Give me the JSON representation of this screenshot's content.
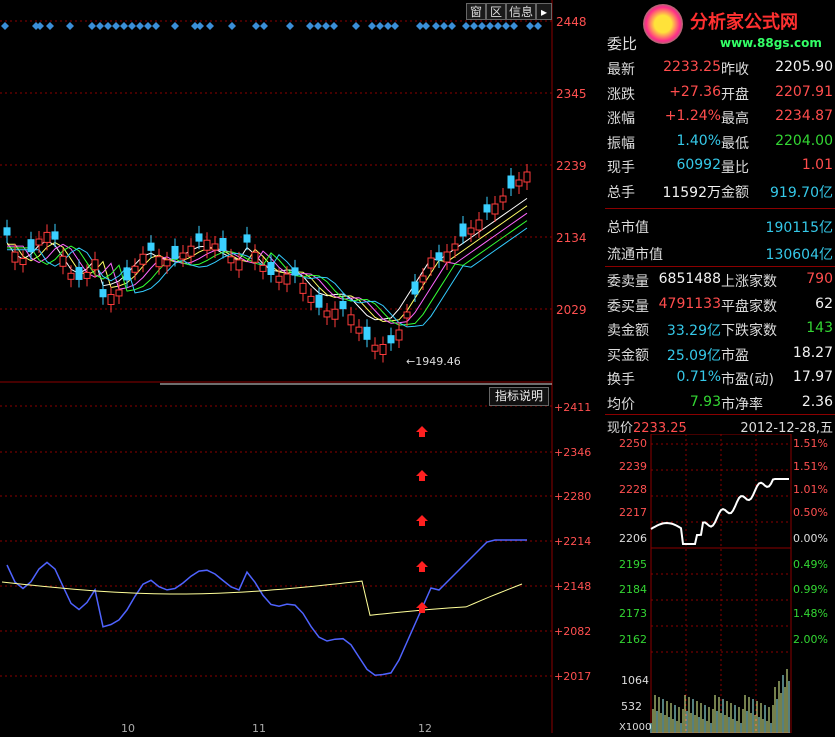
{
  "toolbar": {
    "btn1": "窗",
    "btn2": "区",
    "btn3": "信息",
    "btn4": "▸"
  },
  "kline_axis": [
    "2448",
    "2345",
    "2239",
    "2134",
    "2029"
  ],
  "low_annotation": "1949.46",
  "indicator_button": "指标说明",
  "indicator_axis": [
    "+2411",
    "+2346",
    "+2280",
    "+2214",
    "+2148",
    "+2082",
    "+2017"
  ],
  "month_labels": [
    "10",
    "11",
    "12"
  ],
  "logo": {
    "text": "分析家公式网",
    "url": "www.88gs.com"
  },
  "quote": {
    "wei_bi_label": "委比",
    "rows": [
      {
        "l1": "最新",
        "v1": "2233.25",
        "l2": "昨收",
        "v2": "2205.90",
        "c1": "red",
        "c2": "white"
      },
      {
        "l1": "涨跌",
        "v1": "+27.36",
        "l2": "开盘",
        "v2": "2207.91",
        "c1": "red",
        "c2": "red"
      },
      {
        "l1": "涨幅",
        "v1": "+1.24%",
        "l2": "最高",
        "v2": "2234.87",
        "c1": "red",
        "c2": "red"
      },
      {
        "l1": "振幅",
        "v1": "1.40%",
        "l2": "最低",
        "v2": "2204.00",
        "c1": "cyan",
        "c2": "green"
      },
      {
        "l1": "现手",
        "v1": "60992",
        "l2": "量比",
        "v2": "1.01",
        "c1": "cyan",
        "c2": "red"
      },
      {
        "l1": "总手",
        "v1": "11592万",
        "l2": "金额",
        "v2": "919.70亿",
        "c1": "white",
        "c2": "cyan"
      }
    ],
    "total_cap_label": "总市值",
    "total_cap": "190115亿",
    "float_cap_label": "流通市值",
    "float_cap": "130604亿",
    "rows2": [
      {
        "l1": "委卖量",
        "v1": "6851488",
        "l2": "上涨家数",
        "v2": "790",
        "c1": "white",
        "c2": "red"
      },
      {
        "l1": "委买量",
        "v1": "4791133",
        "l2": "平盘家数",
        "v2": "62",
        "c1": "red",
        "c2": "white"
      },
      {
        "l1": "卖金额",
        "v1": "33.29亿",
        "l2": "下跌家数",
        "v2": "143",
        "c1": "cyan",
        "c2": "green"
      },
      {
        "l1": "买金额",
        "v1": "25.09亿",
        "l2": "市盈",
        "v2": "18.27",
        "c1": "cyan",
        "c2": "white"
      },
      {
        "l1": "换手",
        "v1": "0.71%",
        "l2": "市盈(动)",
        "v2": "17.97",
        "c1": "cyan",
        "c2": "white"
      },
      {
        "l1": "均价",
        "v1": "7.93",
        "l2": "市净率",
        "v2": "2.36",
        "c1": "green",
        "c2": "white"
      }
    ]
  },
  "intraday": {
    "label": "现价",
    "price": "2233.25",
    "date": "2012-12-28,五",
    "prices": [
      "2250",
      "2239",
      "2228",
      "2217",
      "2206",
      "2195",
      "2184",
      "2173",
      "2162"
    ],
    "pcts": [
      "1.51%",
      "1.51%",
      "1.01%",
      "0.50%",
      "0.00%",
      "0.49%",
      "0.99%",
      "1.48%",
      "2.00%"
    ],
    "vols": [
      "1064",
      "532"
    ],
    "vol_unit": "X1000"
  },
  "colors": {
    "up": "#ff3c3c",
    "down": "#3355ff",
    "grid": "#8b0000",
    "ma1": "#ffffff",
    "ma2": "#ffff66",
    "ma3": "#ff66ff",
    "ma4": "#33ff33",
    "ma5": "#33ccff"
  }
}
